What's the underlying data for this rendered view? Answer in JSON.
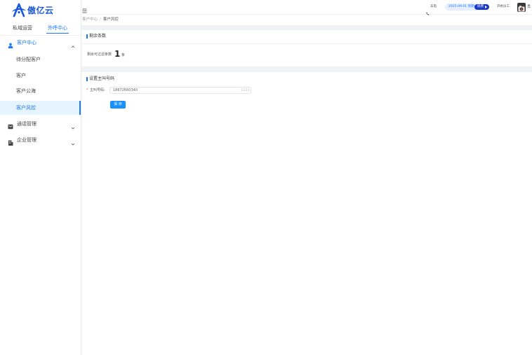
{
  "logo": {
    "text": "傲亿云",
    "icon": "logo-a-icon",
    "color": "#1a56db"
  },
  "sidebar": {
    "tabs": [
      {
        "label": "私域运营",
        "active": false
      },
      {
        "label": "外呼中心",
        "active": true
      }
    ],
    "menu": [
      {
        "label": "客户中心",
        "icon": "user-icon",
        "expanded": true,
        "children": [
          {
            "label": "待分配客户",
            "active": false
          },
          {
            "label": "客户",
            "active": false
          },
          {
            "label": "客户公海",
            "active": false
          },
          {
            "label": "客户风控",
            "active": true
          }
        ]
      },
      {
        "label": "通话管理",
        "icon": "call-log-icon",
        "expanded": false
      },
      {
        "label": "企业管理",
        "icon": "building-icon",
        "expanded": false
      }
    ]
  },
  "header": {
    "fold_icon": "menu-fold-icon",
    "call_label": "去电",
    "expiry_text": "2025-09-01 到期",
    "renew_label": "续费",
    "help_label": "开始派工",
    "user_name": "员"
  },
  "breadcrumb": [
    "客户中心",
    "/",
    "客户风控"
  ],
  "quota": {
    "title": "剩余条数",
    "label": "剩余可过滤条数",
    "value": "1",
    "unit": "条"
  },
  "caller": {
    "title": "设置主叫号码",
    "required_mark": "*",
    "label": "主叫号码:",
    "value": "18672660340",
    "counter": "11/11",
    "save_label": "保 存"
  },
  "colors": {
    "primary": "#1677ff",
    "active_bg": "#e6f4ff",
    "band": "#f0f2f5",
    "badge": "#1d39c4",
    "required": "#ff4d4f",
    "button": "#1890ff"
  }
}
